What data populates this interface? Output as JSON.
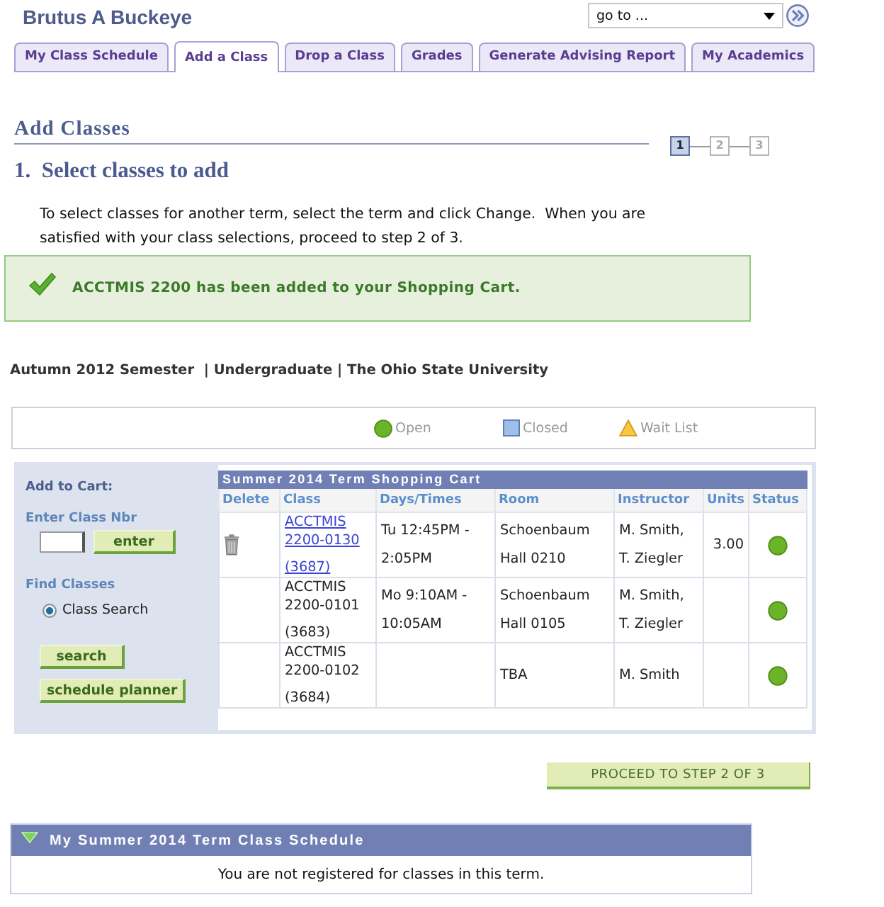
{
  "header": {
    "user_name": "Brutus A Buckeye",
    "goto": {
      "value": "go to ..."
    }
  },
  "tabs": [
    {
      "label": "My Class Schedule",
      "selected": false
    },
    {
      "label": "Add a Class",
      "selected": true
    },
    {
      "label": "Drop a Class",
      "selected": false
    },
    {
      "label": "Grades",
      "selected": false
    },
    {
      "label": "Generate Advising Report",
      "selected": false
    },
    {
      "label": "My Academics",
      "selected": false
    }
  ],
  "page": {
    "title": "Add Classes",
    "steps": [
      {
        "label": "1",
        "selected": true
      },
      {
        "label": "2",
        "selected": false
      },
      {
        "label": "3",
        "selected": false
      }
    ],
    "step_heading": "1.  Select classes to add",
    "instructions": "To select classes for another term, select the term and click Change.  When you are satisfied with your class selections, proceed to step 2 of 3.",
    "message": "ACCTMIS 2200 has been added to your Shopping Cart.",
    "term_info": "Autumn 2012 Semester  | Undergraduate | The Ohio State University"
  },
  "legend": [
    {
      "kind": "open",
      "label": "Open"
    },
    {
      "kind": "closed",
      "label": "Closed"
    },
    {
      "kind": "waitlist",
      "label": "Wait List"
    }
  ],
  "add_to_cart": {
    "title": "Add to Cart:",
    "class_nbr_label": "Enter Class Nbr",
    "enter_button": "enter",
    "find_label": "Find Classes",
    "options": [
      {
        "label": "Class Search",
        "selected": true
      }
    ],
    "search_button": "search",
    "planner_button": "schedule planner"
  },
  "cart": {
    "title": "Summer 2014 Term Shopping Cart",
    "columns": [
      "Delete",
      "Class",
      "Days/Times",
      "Room",
      "Instructor",
      "Units",
      "Status"
    ],
    "rows": [
      {
        "kind": "open",
        "deletable": true,
        "link": true,
        "class": "ACCTMIS 2200-0130",
        "class_nbr": "(3687)",
        "days_times": "Tu 12:45PM - 2:05PM",
        "room": "Schoenbaum Hall 0210",
        "instructor": "M. Smith, T. Ziegler",
        "units": "3.00"
      },
      {
        "kind": "open",
        "deletable": false,
        "link": false,
        "class": "ACCTMIS 2200-0101",
        "class_nbr": "(3683)",
        "days_times": "Mo 9:10AM - 10:05AM",
        "room": "Schoenbaum Hall 0105",
        "instructor": "M. Smith, T. Ziegler"
      },
      {
        "kind": "open",
        "deletable": false,
        "link": false,
        "class": "ACCTMIS 2200-0102",
        "class_nbr": "(3684)",
        "room": "TBA",
        "instructor": "M. Smith"
      }
    ]
  },
  "proceed_button": "PROCEED TO STEP 2 OF 3",
  "schedule": {
    "title": "My Summer 2014 Term Class Schedule",
    "expanded": true,
    "message": "You are not registered for classes in this term."
  }
}
